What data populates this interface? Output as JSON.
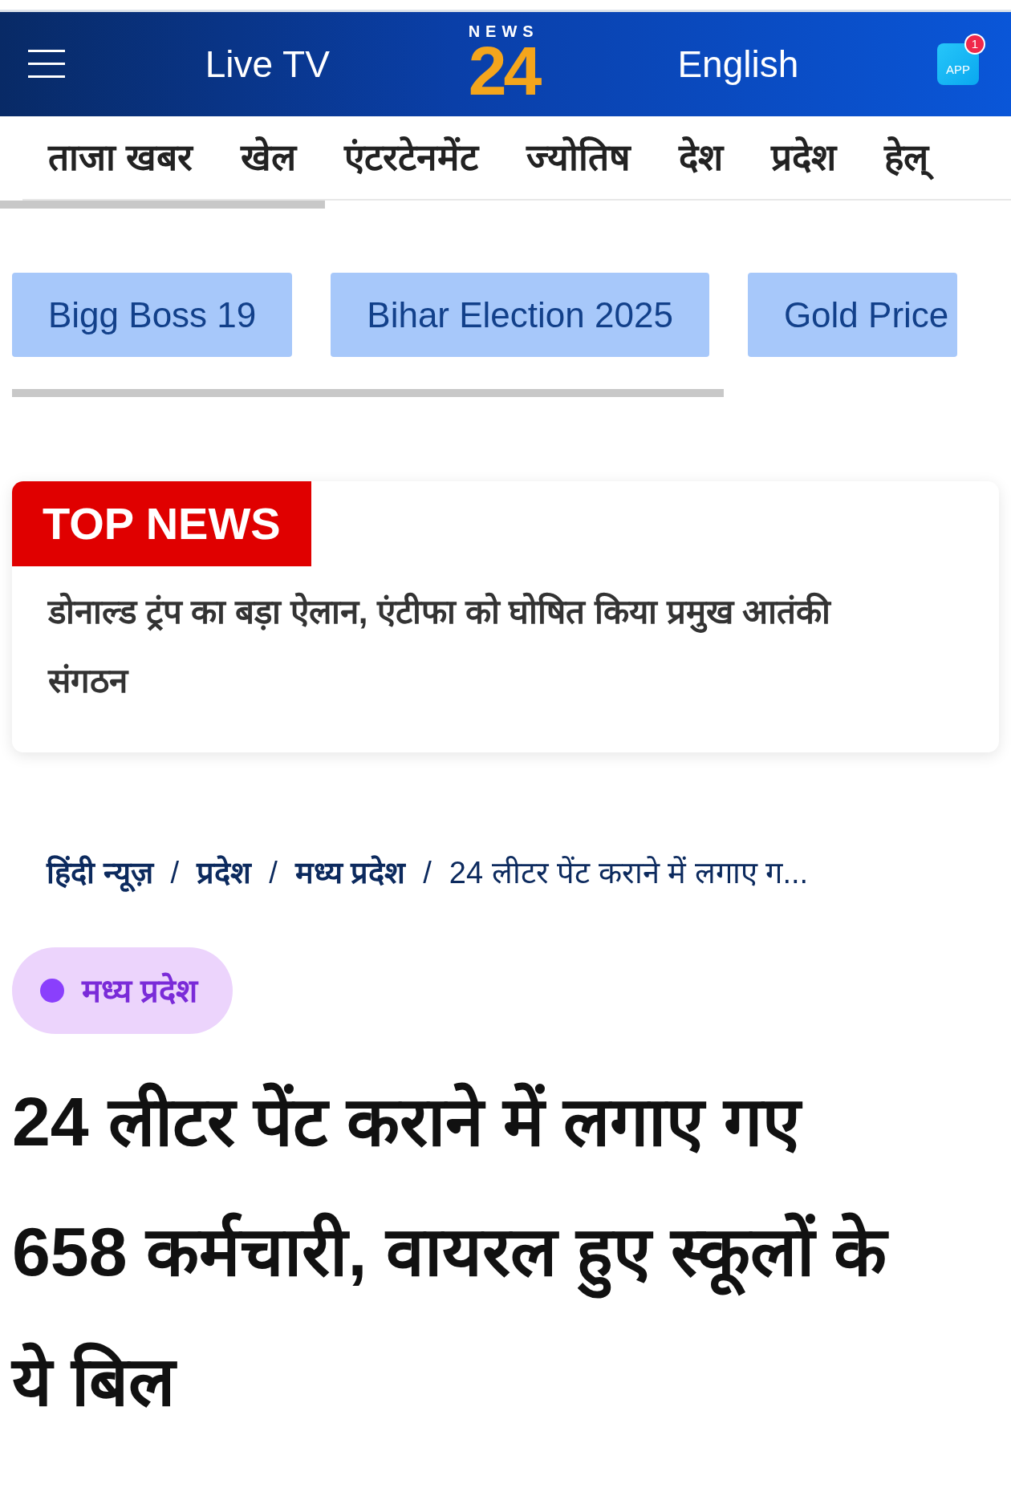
{
  "header": {
    "live_tv": "Live TV",
    "logo": {
      "top": "NEWS",
      "number": "24"
    },
    "language": "English",
    "app": {
      "label": "APP",
      "badge": "1"
    }
  },
  "nav": [
    "ताजा खबर",
    "खेल",
    "एंटरटेनमेंट",
    "ज्योतिष",
    "देश",
    "प्रदेश",
    "हेल्"
  ],
  "trending": [
    "Bigg Boss 19",
    "Bihar Election 2025",
    "Gold Price"
  ],
  "top_news": {
    "label": "TOP NEWS",
    "headline": "डोनाल्ड ट्रंप का बड़ा ऐलान, एंटीफा को घोषित किया प्रमुख आतंकी संगठन"
  },
  "breadcrumb": [
    {
      "label": "हिंदी न्यूज़"
    },
    {
      "separator": "/",
      "label": "प्रदेश"
    },
    {
      "separator": "/",
      "label": "मध्य प्रदेश"
    },
    {
      "separator": "/",
      "label": "24 लीटर पेंट कराने में लगाए ग..."
    }
  ],
  "category": {
    "label": "मध्य प्रदेश",
    "color": "#8a3ffc"
  },
  "title": "24 लीटर पेंट कराने में लगाए गए 658 कर्मचारी, वायरल हुए स्कूलों के ये बिल"
}
